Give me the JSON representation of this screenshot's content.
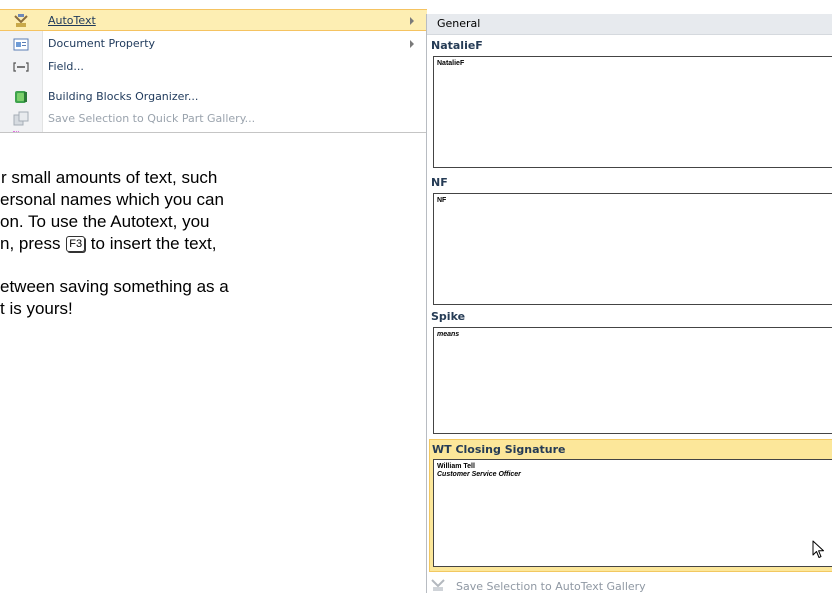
{
  "quick_parts_menu": {
    "items": [
      {
        "label": "AutoText",
        "icon": "autotext-icon",
        "has_submenu": true,
        "highlighted": true,
        "disabled": false
      },
      {
        "label": "Document Property",
        "icon": "document-property-icon",
        "has_submenu": true,
        "highlighted": false,
        "disabled": false
      },
      {
        "label": "Field...",
        "icon": "field-icon",
        "has_submenu": false,
        "highlighted": false,
        "disabled": false
      },
      {
        "label": "Building Blocks Organizer...",
        "icon": "building-blocks-icon",
        "has_submenu": false,
        "highlighted": false,
        "disabled": false
      },
      {
        "label": "Save Selection to Quick Part Gallery...",
        "icon": "save-selection-icon",
        "has_submenu": false,
        "highlighted": false,
        "disabled": true
      }
    ]
  },
  "document_text": {
    "line1": "r small amounts of text, such",
    "line2": "ersonal names which you can",
    "line3": "on. To use the Autotext, you",
    "line4_before": "n, press",
    "key": "F3",
    "line4_after": "to insert the text,",
    "line5": "etween saving something as a",
    "line6": "t is yours!"
  },
  "autotext_gallery": {
    "category": "General",
    "entries": [
      {
        "title": "NatalieF",
        "preview_line1": "NatalieF",
        "preview_line2": "",
        "selected": false
      },
      {
        "title": "NF",
        "preview_line1": "NF",
        "preview_line2": "",
        "selected": false
      },
      {
        "title": "Spike",
        "preview_line1": "means",
        "preview_line2": "",
        "selected": false
      },
      {
        "title": "WT Closing Signature",
        "preview_line1": "William Tell",
        "preview_line2": "Customer Service Officer",
        "selected": true
      }
    ],
    "footer_label": "Save Selection to AutoText Gallery"
  },
  "colors": {
    "highlight_fill": "#fdeeb3",
    "highlight_border": "#f5c361",
    "menu_text": "#1e395b",
    "disabled_text": "#9aa3ad"
  }
}
